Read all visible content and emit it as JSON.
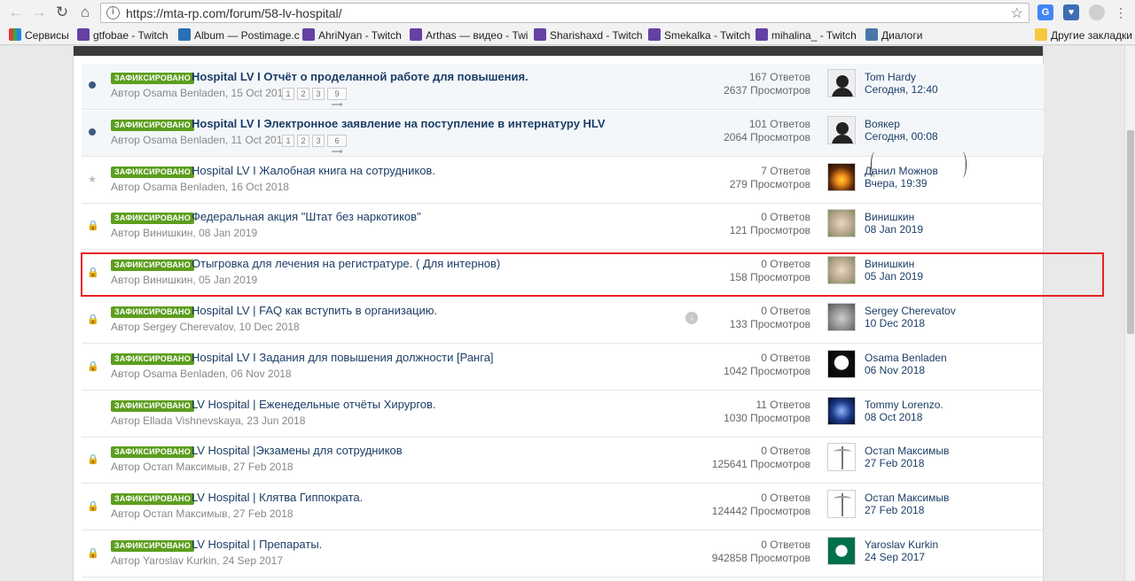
{
  "browser": {
    "url": "https://mta-rp.com/forum/58-lv-hospital/",
    "bookmarks": [
      {
        "label": "Сервисы",
        "icon": "apps-icon"
      },
      {
        "label": "gtfobae - Twitch",
        "icon": "twitch-icon"
      },
      {
        "label": "Album — Postimage.c",
        "icon": "postimage-icon"
      },
      {
        "label": "AhriNyan - Twitch",
        "icon": "twitch-icon"
      },
      {
        "label": "Arthas — видео - Twi",
        "icon": "twitch-icon"
      },
      {
        "label": "Sharishaxd - Twitch",
        "icon": "twitch-icon"
      },
      {
        "label": "Smekalka - Twitch",
        "icon": "twitch-icon"
      },
      {
        "label": "mihalina_ - Twitch",
        "icon": "twitch-icon"
      },
      {
        "label": "Диалоги",
        "icon": "vk-icon"
      }
    ],
    "other_bookmarks": "Другие закладки"
  },
  "topics": [
    {
      "status": "unread",
      "badge": "ЗАФИКСИРОВАНО",
      "title": "Hospital LV I Отчёт о проделанной работе для повышения.",
      "bold": true,
      "author": "Автор Osama Benladen, 15 Oct 2018",
      "pages": [
        "1",
        "2",
        "3",
        "9 ⟶"
      ],
      "replies": "167 Ответов",
      "views": "2637 Просмотров",
      "last_user": "Tom Hardy",
      "last_date": "Сегодня, 12:40",
      "avatar": "avatar-dark"
    },
    {
      "status": "unread",
      "badge": "ЗАФИКСИРОВАНО",
      "title": "Hospital LV I Электронное заявление на поступление в интернатуру HLV",
      "bold": true,
      "author": "Автор Osama Benladen, 11 Oct 2018",
      "pages": [
        "1",
        "2",
        "3",
        "6 ⟶"
      ],
      "replies": "101 Ответов",
      "views": "2064 Просмотров",
      "last_user": "Воякер",
      "last_date": "Сегодня, 00:08",
      "avatar": "avatar-dark"
    },
    {
      "status": "star",
      "badge": "ЗАФИКСИРОВАНО",
      "title": "Hospital LV I Жалобная книга на сотрудников.",
      "bold": false,
      "author": "Автор Osama Benladen, 16 Oct 2018",
      "pages": [],
      "replies": "7 Ответов",
      "views": "279 Просмотров",
      "last_user": "Данил Можнов",
      "last_date": "Вчера, 19:39",
      "avatar": "avatar-candle"
    },
    {
      "status": "locked",
      "badge": "ЗАФИКСИРОВАНО",
      "title": "Федеральная акция \"Штат без наркотиков\"",
      "bold": false,
      "author": "Автор Винишкин, 08 Jan 2019",
      "pages": [],
      "replies": "0 Ответов",
      "views": "121 Просмотров",
      "last_user": "Винишкин",
      "last_date": "08 Jan 2019",
      "avatar": "avatar-pig"
    },
    {
      "status": "locked",
      "badge": "ЗАФИКСИРОВАНО",
      "title": "Отыгровка для лечения на регистратуре. ( Для интернов)",
      "bold": false,
      "author": "Автор Винишкин, 05 Jan 2019",
      "pages": [],
      "replies": "0 Ответов",
      "views": "158 Просмотров",
      "last_user": "Винишкин",
      "last_date": "05 Jan 2019",
      "avatar": "avatar-pig"
    },
    {
      "status": "locked",
      "badge": "ЗАФИКСИРОВАНО",
      "title": "Hospital LV | FAQ как вступить в организацию.",
      "bold": false,
      "author": "Автор Sergey Cherevatov, 10 Dec 2018",
      "pages": [],
      "replies": "0 Ответов",
      "views": "133 Просмотров",
      "last_user": "Sergey Cherevatov",
      "last_date": "10 Dec 2018",
      "avatar": "avatar-cat",
      "download": true
    },
    {
      "status": "locked",
      "badge": "ЗАФИКСИРОВАНО",
      "title": "Hospital LV I Задания для повышения должности [Ранга]",
      "bold": false,
      "author": "Автор Osama Benladen, 06 Nov 2018",
      "pages": [],
      "replies": "0 Ответов",
      "views": "1042 Просмотров",
      "last_user": "Osama Benladen",
      "last_date": "06 Nov 2018",
      "avatar": "avatar-skull"
    },
    {
      "status": "none",
      "badge": "ЗАФИКСИРОВАНО",
      "title": "LV Hospital | Еженедельные отчёты Хирургов.",
      "bold": false,
      "author": "Автор Ellada Vishnevskaya, 23 Jun 2018",
      "pages": [],
      "replies": "11 Ответов",
      "views": "1030 Просмотров",
      "last_user": "Tommy Lorenzo.",
      "last_date": "08 Oct 2018",
      "avatar": "avatar-blue"
    },
    {
      "status": "locked",
      "badge": "ЗАФИКСИРОВАНО",
      "title": "LV Hospital |Экзамены для сотрудников",
      "bold": false,
      "author": "Автор Остап Максимыв, 27 Feb 2018",
      "pages": [],
      "replies": "0 Ответов",
      "views": "125641 Просмотров",
      "last_user": "Остап Максимыв",
      "last_date": "27 Feb 2018",
      "avatar": "avatar-caduceus"
    },
    {
      "status": "locked",
      "badge": "ЗАФИКСИРОВАНО",
      "title": "LV Hospital | Клятва Гиппократа.",
      "bold": false,
      "author": "Автор Остап Максимыв, 27 Feb 2018",
      "pages": [],
      "replies": "0 Ответов",
      "views": "124442 Просмотров",
      "last_user": "Остап Максимыв",
      "last_date": "27 Feb 2018",
      "avatar": "avatar-caduceus"
    },
    {
      "status": "locked",
      "badge": "ЗАФИКСИРОВАНО",
      "title": "LV Hospital | Препараты.",
      "bold": false,
      "author": "Автор Yaroslav Kurkin, 24 Sep 2017",
      "pages": [],
      "replies": "0 Ответов",
      "views": "942858 Просмотров",
      "last_user": "Yaroslav Kurkin",
      "last_date": "24 Sep 2017",
      "avatar": "avatar-starbucks"
    }
  ],
  "colors": {
    "accent": "#1c3e66",
    "badge": "#5d9e1f",
    "highlight_box": "#e52424"
  }
}
